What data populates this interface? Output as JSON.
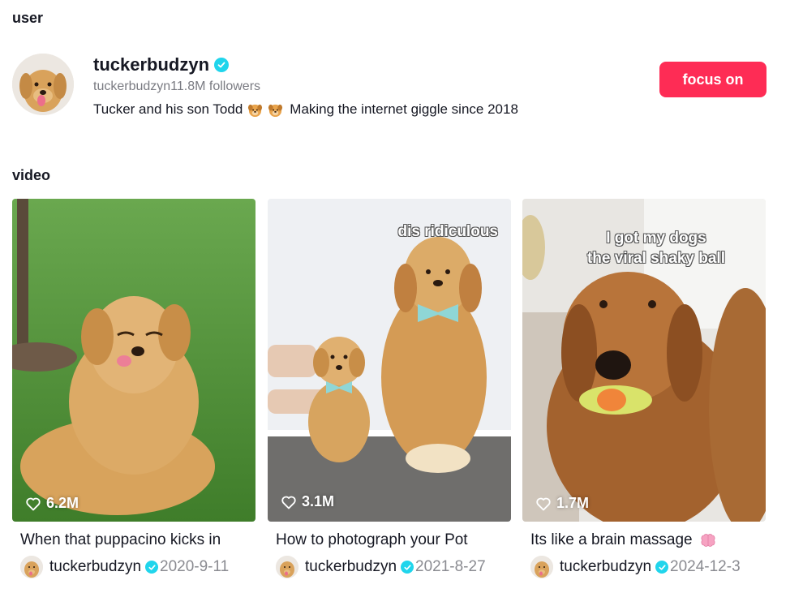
{
  "sections": {
    "user_title": "user",
    "video_title": "video"
  },
  "user": {
    "name": "tuckerbudzyn",
    "followers_line": "tuckerbudzyn11.8M followers",
    "bio_start": "Tucker and his son Todd",
    "bio_end": "Making the internet giggle since 2018",
    "bio_emojis": [
      "dog-face-emoji",
      "dog-face-emoji"
    ],
    "verified": true,
    "follow_button": "focus on"
  },
  "colors": {
    "accent": "#fe2c55",
    "verified": "#20d5ec",
    "muted_text": "#8a8b91"
  },
  "videos": [
    {
      "likes": "6.2M",
      "caption": "When that puppacino kicks in",
      "author": "tuckerbudzyn",
      "date": "2020-9-11",
      "overlay": ""
    },
    {
      "likes": "3.1M",
      "caption": "How to photograph your Pot",
      "author": "tuckerbudzyn",
      "date": "2021-8-27",
      "overlay": "dis ridiculous"
    },
    {
      "likes": "1.7M",
      "caption": "Its like a brain massage",
      "author": "tuckerbudzyn",
      "date": "2024-12-3",
      "overlay_line1": "I got my dogs",
      "overlay_line2": "the viral shaky ball"
    }
  ]
}
